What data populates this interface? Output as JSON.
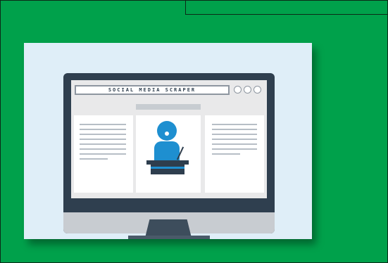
{
  "illustration": {
    "browser_title": "SOCIAL MEDIA SCRAPER"
  },
  "colors": {
    "background": "#00a14b",
    "card": "#dfeef8",
    "monitor": "#2f3f4f",
    "accent": "#1e8fd0"
  }
}
